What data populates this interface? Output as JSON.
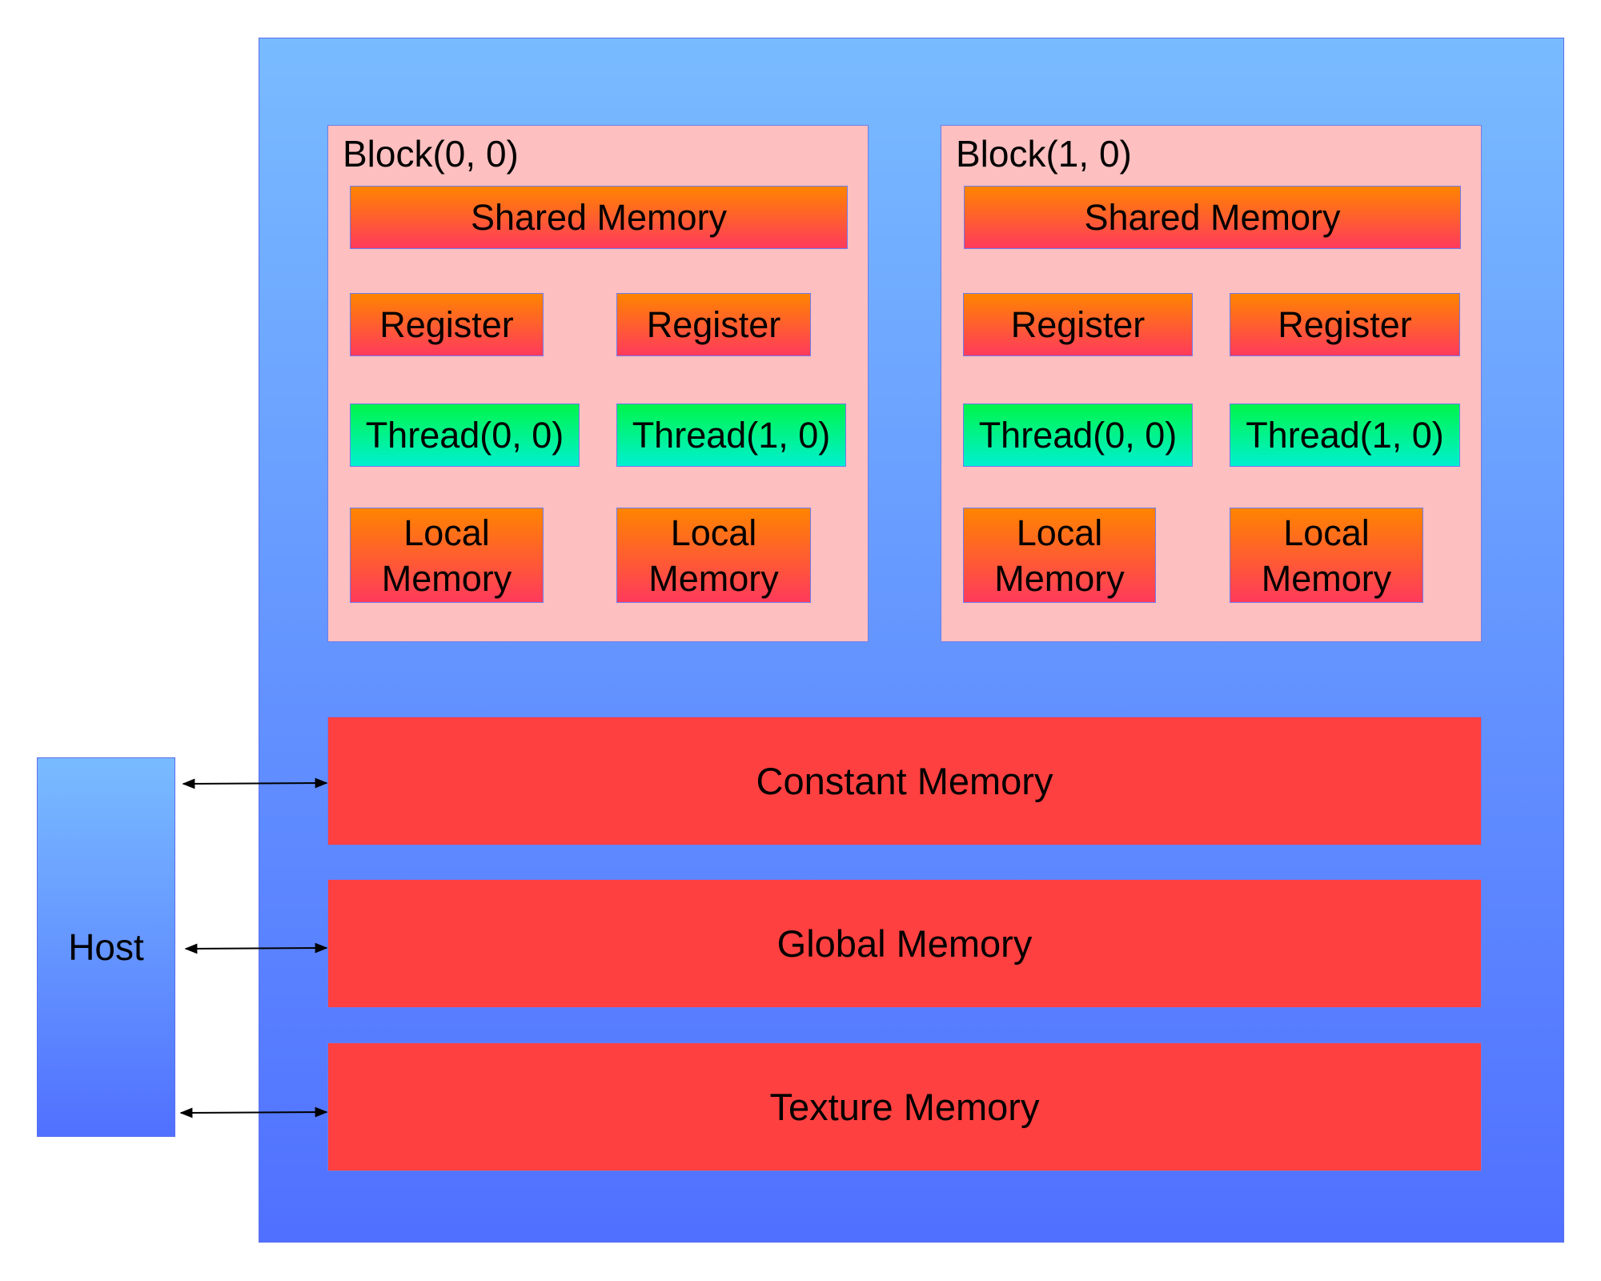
{
  "host": {
    "label": "Host"
  },
  "blocks": [
    {
      "title": "Block(0, 0)",
      "shared": "Shared Memory",
      "registers": [
        "Register",
        "Register"
      ],
      "threads": [
        "Thread(0, 0)",
        "Thread(1, 0)"
      ],
      "locals": [
        "Local\nMemory",
        "Local\nMemory"
      ]
    },
    {
      "title": "Block(1, 0)",
      "shared": "Shared Memory",
      "registers": [
        "Register",
        "Register"
      ],
      "threads": [
        "Thread(0, 0)",
        "Thread(1, 0)"
      ],
      "locals": [
        "Local\nMemory",
        "Local\nMemory"
      ]
    }
  ],
  "device_memories": [
    "Constant Memory",
    "Global Memory",
    "Texture Memory"
  ],
  "colors": {
    "grid_top": "#79bbff",
    "grid_bottom": "#5070ff",
    "block": "#fdbfbf",
    "memory_top": "#ff8400",
    "memory_bottom": "#ff3a5c",
    "thread_top": "#00f54a",
    "thread_bottom": "#00f0d0",
    "device_memory": "#ff4040"
  }
}
